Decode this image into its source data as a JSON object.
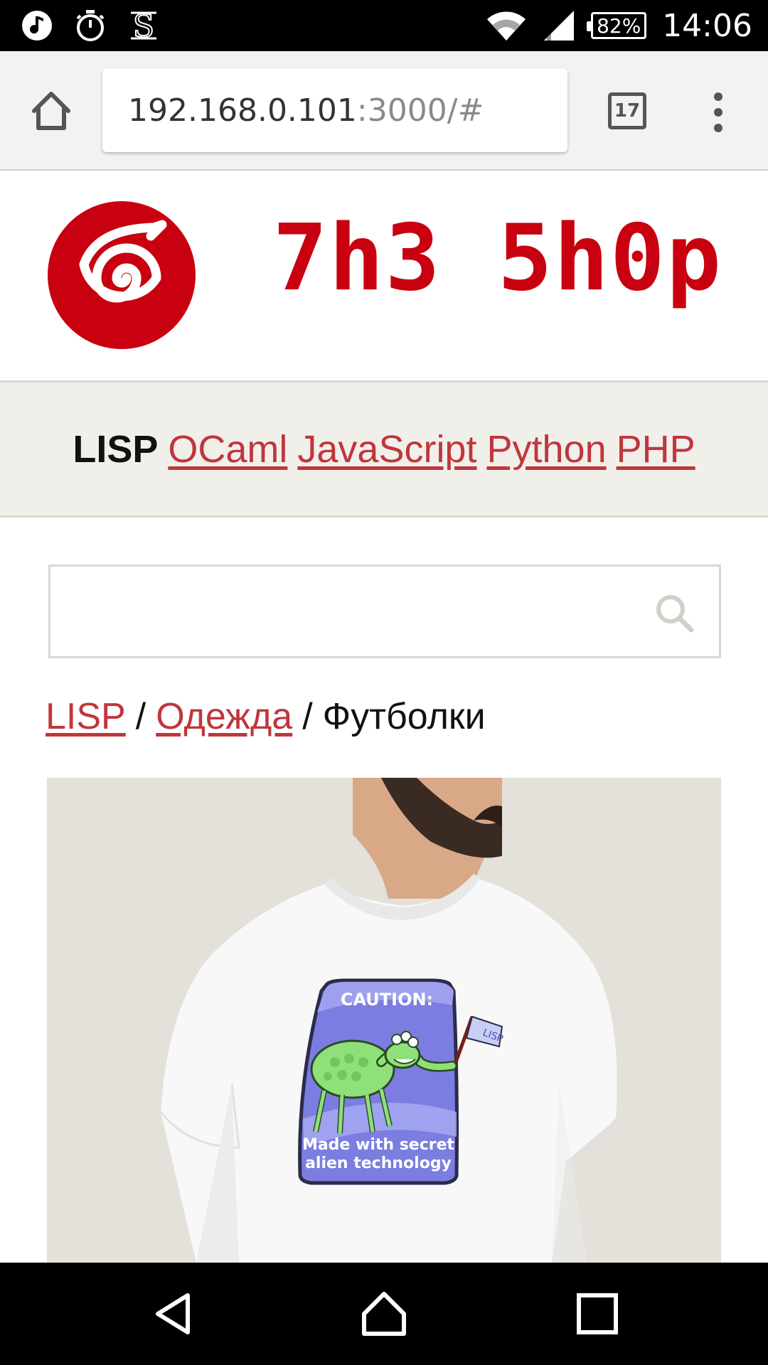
{
  "status_bar": {
    "left_icons": [
      "music-note-icon",
      "stopwatch-icon",
      "s-app-icon"
    ],
    "battery_percent": "82%",
    "time": "14:06"
  },
  "browser": {
    "url_host": "192.168.0.101",
    "url_rest": ":3000/#",
    "tab_count": "17"
  },
  "site": {
    "title": "7h3 5h0p",
    "brand_color": "#c8000f"
  },
  "categories": {
    "current": "LISP",
    "links": [
      "OCaml",
      "JavaScript",
      "Python",
      "PHP"
    ]
  },
  "search": {
    "value": "",
    "placeholder": ""
  },
  "breadcrumb": {
    "items": [
      "LISP",
      "Одежда"
    ],
    "current": "Футболки",
    "separator": "/"
  },
  "product": {
    "badge_title": "CAUTION:",
    "flag_text": "LISP",
    "badge_line1": "Made with secret",
    "badge_line2": "alien technology"
  }
}
